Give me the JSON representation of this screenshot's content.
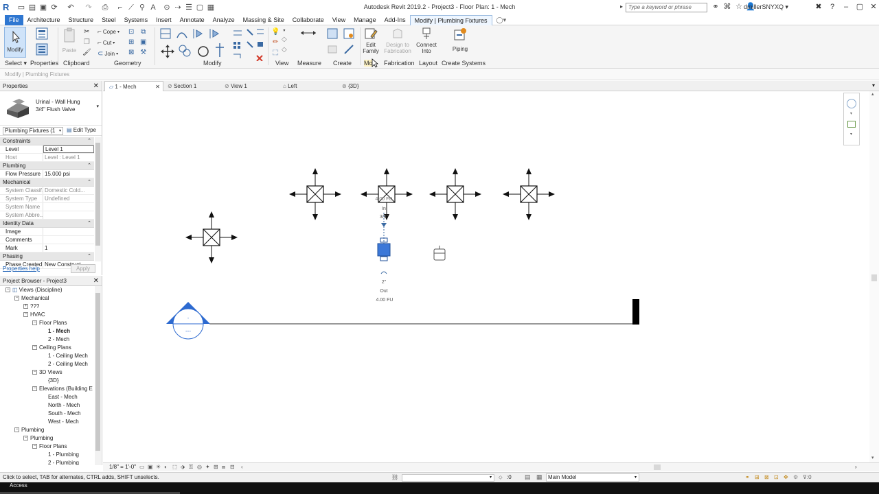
{
  "titlebar": {
    "app_title": "Autodesk Revit 2019.2 - Project3 - Floor Plan: 1 - Mech",
    "search_placeholder": "Type a keyword or phrase",
    "user": "dmillerSNYXQ"
  },
  "ribbon_tabs": [
    "File",
    "Architecture",
    "Structure",
    "Steel",
    "Systems",
    "Insert",
    "Annotate",
    "Analyze",
    "Massing & Site",
    "Collaborate",
    "View",
    "Manage",
    "Add-Ins",
    "Modify | Plumbing Fixtures"
  ],
  "ribbon": {
    "modify": "Modify",
    "paste": "Paste",
    "cope": "Cope",
    "cut": "Cut",
    "join": "Join",
    "edit_family": [
      "Edit",
      "Family"
    ],
    "design_to_fabrication": [
      "Design to",
      "Fabrication"
    ],
    "connect_into": [
      "Connect",
      "Into"
    ],
    "piping": "Piping",
    "panels": {
      "select": "Select",
      "properties": "Properties",
      "clipboard": "Clipboard",
      "geometry": "Geometry",
      "modify": "Modify",
      "view": "View",
      "measure": "Measure",
      "create": "Create",
      "mode": "Mo",
      "fabrication": "Fabrication",
      "layout": "Layout",
      "create_systems": "Create Systems"
    }
  },
  "optionsbar": {
    "context": "Modify | Plumbing Fixtures"
  },
  "properties": {
    "header": "Properties",
    "type_name_1": "Urinal - Wall Hung",
    "type_name_2": "3/4\" Flush Valve",
    "filter": "Plumbing Fixtures (1",
    "edit_type": "Edit Type",
    "categories": {
      "constraints": "Constraints",
      "plumbing": "Plumbing",
      "mechanical": "Mechanical",
      "identity": "Identity Data",
      "phasing": "Phasing"
    },
    "rows": {
      "level_k": "Level",
      "level_v": "Level 1",
      "host_k": "Host",
      "host_v": "Level : Level 1",
      "flow_k": "Flow Pressure",
      "flow_v": "15.000 psi",
      "sysclass_k": "System Classif...",
      "sysclass_v": "Domestic Cold...",
      "systype_k": "System Type",
      "systype_v": "Undefined",
      "sysname_k": "System Name",
      "sysname_v": "",
      "sysabbr_k": "System Abbre...",
      "sysabbr_v": "",
      "image_k": "Image",
      "image_v": "",
      "comments_k": "Comments",
      "comments_v": "",
      "mark_k": "Mark",
      "mark_v": "1",
      "phase_k": "Phase Created",
      "phase_v": "New Construct..."
    },
    "help_link": "Properties help",
    "apply": "Apply"
  },
  "browser": {
    "header": "Project Browser - Project3",
    "nodes": [
      {
        "label": "Views (Discipline)",
        "level": 0,
        "tog": "−",
        "bold": false
      },
      {
        "label": "Mechanical",
        "level": 1,
        "tog": "−",
        "bold": false
      },
      {
        "label": "???",
        "level": 2,
        "tog": "+",
        "bold": false
      },
      {
        "label": "HVAC",
        "level": 2,
        "tog": "−",
        "bold": false
      },
      {
        "label": "Floor Plans",
        "level": 3,
        "tog": "−",
        "bold": false
      },
      {
        "label": "1 - Mech",
        "level": 4,
        "tog": "",
        "bold": true
      },
      {
        "label": "2 - Mech",
        "level": 4,
        "tog": "",
        "bold": false
      },
      {
        "label": "Ceiling Plans",
        "level": 3,
        "tog": "−",
        "bold": false
      },
      {
        "label": "1 - Ceiling Mech",
        "level": 4,
        "tog": "",
        "bold": false
      },
      {
        "label": "2 - Ceiling Mech",
        "level": 4,
        "tog": "",
        "bold": false
      },
      {
        "label": "3D Views",
        "level": 3,
        "tog": "−",
        "bold": false
      },
      {
        "label": "{3D}",
        "level": 4,
        "tog": "",
        "bold": false
      },
      {
        "label": "Elevations (Building E",
        "level": 3,
        "tog": "−",
        "bold": false
      },
      {
        "label": "East - Mech",
        "level": 4,
        "tog": "",
        "bold": false
      },
      {
        "label": "North - Mech",
        "level": 4,
        "tog": "",
        "bold": false
      },
      {
        "label": "South - Mech",
        "level": 4,
        "tog": "",
        "bold": false
      },
      {
        "label": "West - Mech",
        "level": 4,
        "tog": "",
        "bold": false
      },
      {
        "label": "Plumbing",
        "level": 1,
        "tog": "−",
        "bold": false
      },
      {
        "label": "Plumbing",
        "level": 2,
        "tog": "−",
        "bold": false
      },
      {
        "label": "Floor Plans",
        "level": 3,
        "tog": "−",
        "bold": false
      },
      {
        "label": "1 - Plumbing",
        "level": 4,
        "tog": "",
        "bold": false
      },
      {
        "label": "2 - Plumbing",
        "level": 4,
        "tog": "",
        "bold": false
      }
    ]
  },
  "viewtabs": [
    "1 - Mech",
    "Section 1",
    "View 1",
    "Left",
    "{3D}"
  ],
  "canvas": {
    "fixture_labels": {
      "in_top": "4.00 FU",
      "in": "In",
      "size_top": "3/4\"",
      "size_bottom": "2\"",
      "out": "Out",
      "out_fu": "4.00 FU"
    },
    "section_head_top": "-",
    "section_head_bottom": "---"
  },
  "viewctrl": {
    "scale": "1/8\" = 1'-0\""
  },
  "statusbar": {
    "message": "Click to select, TAB for alternates, CTRL adds, SHIFT unselects.",
    "zero": ":0",
    "model": "Main Model"
  },
  "taskbar": {
    "access": "Access"
  }
}
